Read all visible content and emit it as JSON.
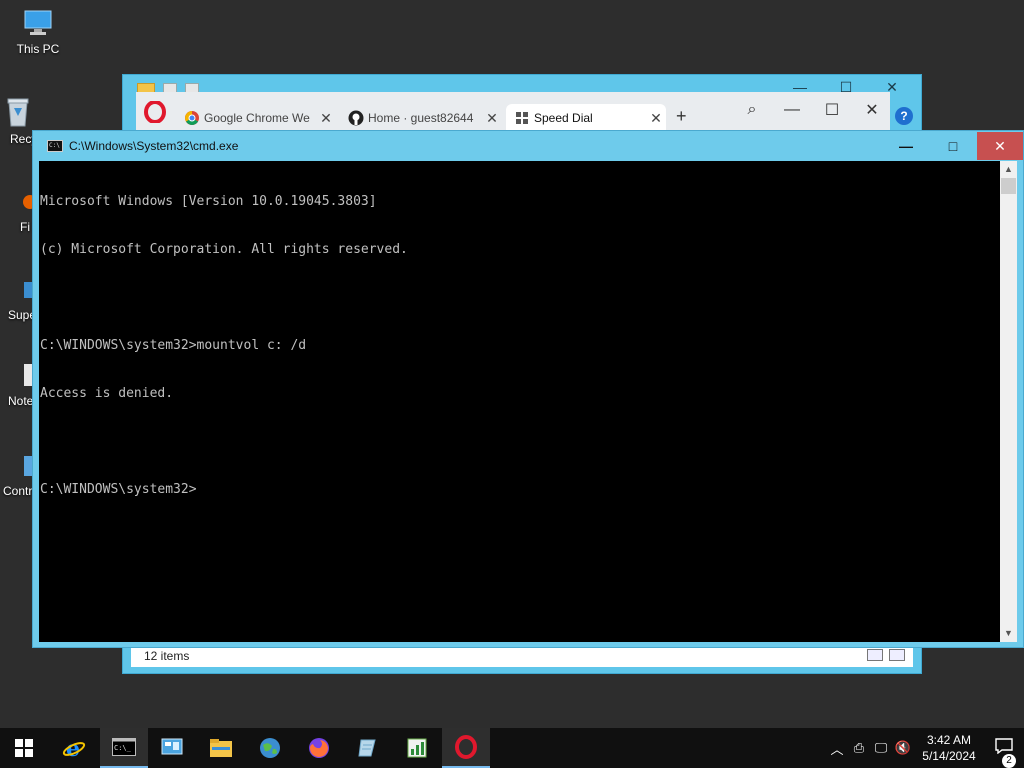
{
  "desktop": {
    "icons": [
      {
        "label": "This PC",
        "icon": "this-pc-icon"
      },
      {
        "label": "Recy",
        "icon": "recycle-bin-icon"
      },
      {
        "label": "Fi",
        "icon": "firefox-shortcut-icon"
      },
      {
        "label": "Supe",
        "icon": "super-app-icon"
      },
      {
        "label": "Note",
        "icon": "notepad-icon"
      },
      {
        "label": "Contr",
        "icon": "control-panel-icon"
      }
    ]
  },
  "explorer": {
    "status_items": "12 items",
    "help_glyph": "?"
  },
  "opera": {
    "tabs": [
      {
        "label": "Google Chrome We",
        "icon": "chrome-icon",
        "close": "✕"
      },
      {
        "label": "Home · guest82644",
        "icon": "github-icon",
        "close": "✕"
      },
      {
        "label": "Speed Dial",
        "icon": "speed-dial-icon",
        "close": "✕"
      }
    ],
    "new_tab": "+",
    "search_glyph": "⌕",
    "minimize": "—",
    "maximize": "☐",
    "close": "✕"
  },
  "cmd": {
    "title": "C:\\Windows\\System32\\cmd.exe",
    "minimize": "—",
    "maximize": "□",
    "close": "✕",
    "lines": [
      "Microsoft Windows [Version 10.0.19045.3803]",
      "(c) Microsoft Corporation. All rights reserved.",
      "",
      "C:\\WINDOWS\\system32>mountvol c: /d",
      "Access is denied.",
      "",
      "C:\\WINDOWS\\system32>"
    ]
  },
  "taskbar": {
    "items": [
      {
        "icon": "start-windows-icon"
      },
      {
        "icon": "internet-explorer-icon"
      },
      {
        "icon": "command-prompt-icon",
        "active": true
      },
      {
        "icon": "control-panel-icon"
      },
      {
        "icon": "file-explorer-icon"
      },
      {
        "icon": "network-globe-icon"
      },
      {
        "icon": "firefox-icon"
      },
      {
        "icon": "notepad-app-icon"
      },
      {
        "icon": "chart-app-icon"
      },
      {
        "icon": "opera-icon",
        "active": true
      }
    ],
    "tray": {
      "time": "3:42 AM",
      "date": "5/14/2024",
      "notifications": "2"
    }
  },
  "colors": {
    "window_frame": "#6ecbeb",
    "close_red": "#c75050",
    "console_bg": "#000000",
    "console_text": "#c0c0c0",
    "taskbar": "#101010",
    "desktop": "#2d2d2d"
  }
}
